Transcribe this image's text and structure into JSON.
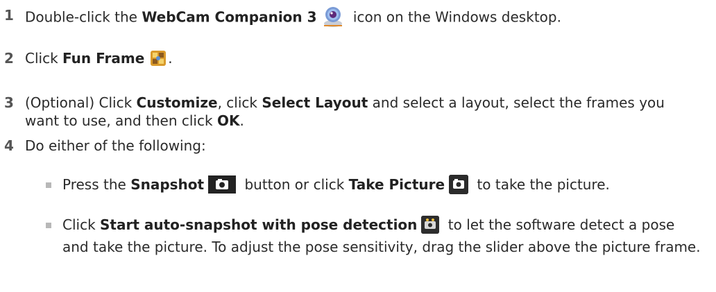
{
  "steps": [
    {
      "number": "1",
      "pre": "Double-click the ",
      "bold": "WebCam Companion 3",
      "post": " icon on the Windows desktop.",
      "icon": "webcam-companion-icon"
    },
    {
      "number": "2",
      "pre": "Click ",
      "bold": "Fun Frame",
      "post": ".",
      "icon": "fun-frame-icon"
    },
    {
      "number": "3",
      "t1": "(Optional) Click ",
      "b1": "Customize",
      "t2": ", click ",
      "b2": "Select Layout",
      "t3": " and select a layout, select the frames you want to use, and then click ",
      "b3": "OK",
      "t4": "."
    },
    {
      "number": "4",
      "text": "Do either of the following:"
    }
  ],
  "bullets": [
    {
      "t1": "Press the ",
      "b1": "Snapshot",
      "t2": " button or click ",
      "b2": "Take Picture",
      "t3": " to take the picture.",
      "icons": [
        "snapshot-button-icon",
        "take-picture-icon"
      ]
    },
    {
      "t1": "Click ",
      "b1": "Start auto-snapshot with pose detection",
      "t2": " to let the software detect a pose and take the picture. To adjust the pose sensitivity, drag the slider above the picture frame.",
      "icons": [
        "pose-detection-icon"
      ]
    }
  ],
  "colors": {
    "text": "#2a2a2a",
    "number": "#555555",
    "bullet": "#b8b8b8"
  }
}
